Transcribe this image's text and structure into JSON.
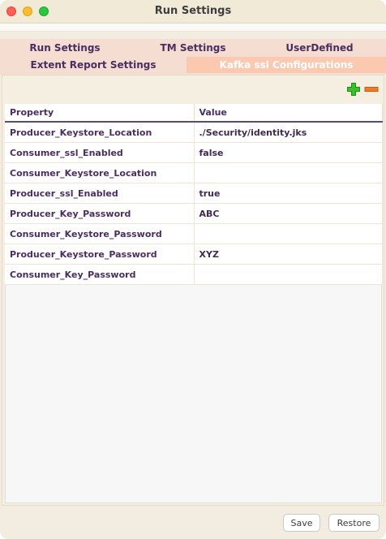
{
  "window": {
    "title": "Run Settings"
  },
  "tabs": {
    "row1": [
      "Run Settings",
      "TM Settings",
      "UserDefined"
    ],
    "row2": [
      "Extent Report Settings",
      "Kafka ssl Configurations"
    ],
    "selected": "Kafka ssl Configurations"
  },
  "toolbar": {
    "add_icon": "plus-icon",
    "remove_icon": "minus-icon"
  },
  "table": {
    "headers": [
      "Property",
      "Value"
    ],
    "rows": [
      {
        "property": "Producer_Keystore_Location",
        "value": "./Security/identity.jks"
      },
      {
        "property": "Consumer_ssl_Enabled",
        "value": "false"
      },
      {
        "property": "Consumer_Keystore_Location",
        "value": ""
      },
      {
        "property": "Producer_ssl_Enabled",
        "value": "true"
      },
      {
        "property": "Producer_Key_Password",
        "value": "ABC"
      },
      {
        "property": "Consumer_Keystore_Password",
        "value": ""
      },
      {
        "property": "Producer_Keystore_Password",
        "value": "XYZ"
      },
      {
        "property": "Consumer_Key_Password",
        "value": ""
      }
    ]
  },
  "buttons": {
    "save": "Save",
    "restore": "Restore"
  },
  "colors": {
    "accent_tab": "#fbc8b0",
    "tab_bg": "#f6ddd2",
    "text": "#4a2e62"
  }
}
